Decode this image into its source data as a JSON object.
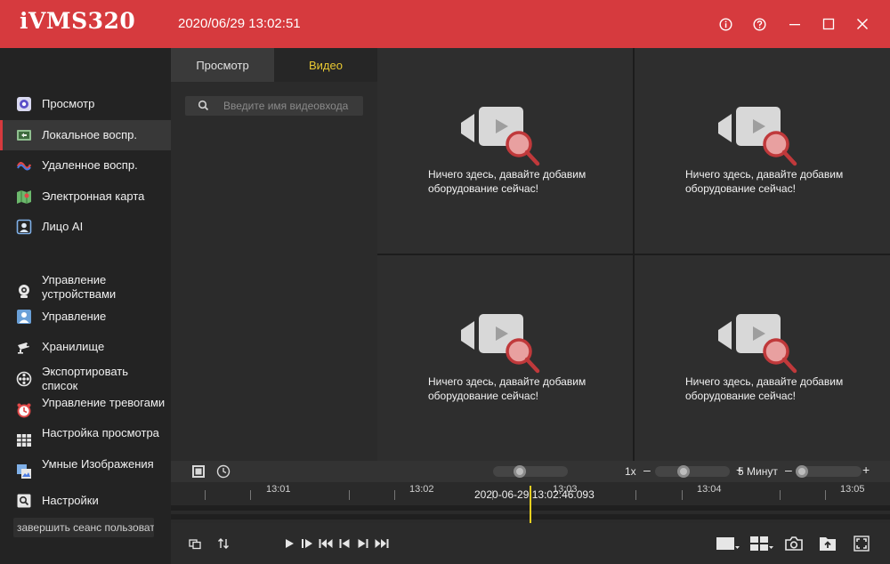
{
  "app": {
    "title": "iVMS320",
    "datetime": "2020/06/29 13:02:51"
  },
  "window_controls": [
    "info-icon",
    "help-icon",
    "minimize-icon",
    "maximize-icon",
    "close-icon"
  ],
  "colors": {
    "brand": "#d63a3e",
    "active_tab": "#e8c832",
    "timeline_cursor": "#e8d020"
  },
  "sidebar": {
    "items": [
      {
        "label": "Просмотр",
        "icon": "live-view-icon"
      },
      {
        "label": "Локальное воспр.",
        "icon": "local-playback-icon",
        "active": true
      },
      {
        "label": "Удаленное воспр.",
        "icon": "remote-playback-icon"
      },
      {
        "label": "Электронная карта",
        "icon": "emap-icon"
      },
      {
        "label": "Лицо AI",
        "icon": "face-ai-icon"
      },
      {
        "label": "Управление устройствами",
        "icon": "device-management-icon"
      },
      {
        "label": "Управление",
        "icon": "user-management-icon"
      },
      {
        "label": "Хранилище",
        "icon": "storage-icon"
      },
      {
        "label": "Экспортировать список",
        "icon": "export-list-icon"
      },
      {
        "label": "Управление тревогами",
        "icon": "alarm-icon"
      },
      {
        "label": "Настройка просмотра",
        "icon": "view-settings-icon"
      },
      {
        "label": "Умные Изображения",
        "icon": "smart-images-icon"
      },
      {
        "label": "Настройки",
        "icon": "settings-icon"
      }
    ],
    "logout_label": "завершить сеанс пользовател"
  },
  "panel": {
    "tabs": [
      {
        "label": "Просмотр"
      },
      {
        "label": "Видео",
        "active": true
      }
    ],
    "search_placeholder": "Введите имя видеовхода"
  },
  "grid": {
    "cells": [
      {
        "message": "Ничего здесь, давайте добавим оборудование сейчас!"
      },
      {
        "message": "Ничего здесь, давайте добавим оборудование сейчас!"
      },
      {
        "message": "Ничего здесь, давайте добавим оборудование сейчас!"
      },
      {
        "message": "Ничего здесь, давайте добавим оборудование сейчас!"
      }
    ]
  },
  "timeline": {
    "speed": "1x",
    "span": "5 Минут",
    "ticks": [
      "13:01",
      "13:02",
      "13:03",
      "13:04",
      "13:05"
    ],
    "cursor": "2020-06-29   13:02:46.093"
  }
}
